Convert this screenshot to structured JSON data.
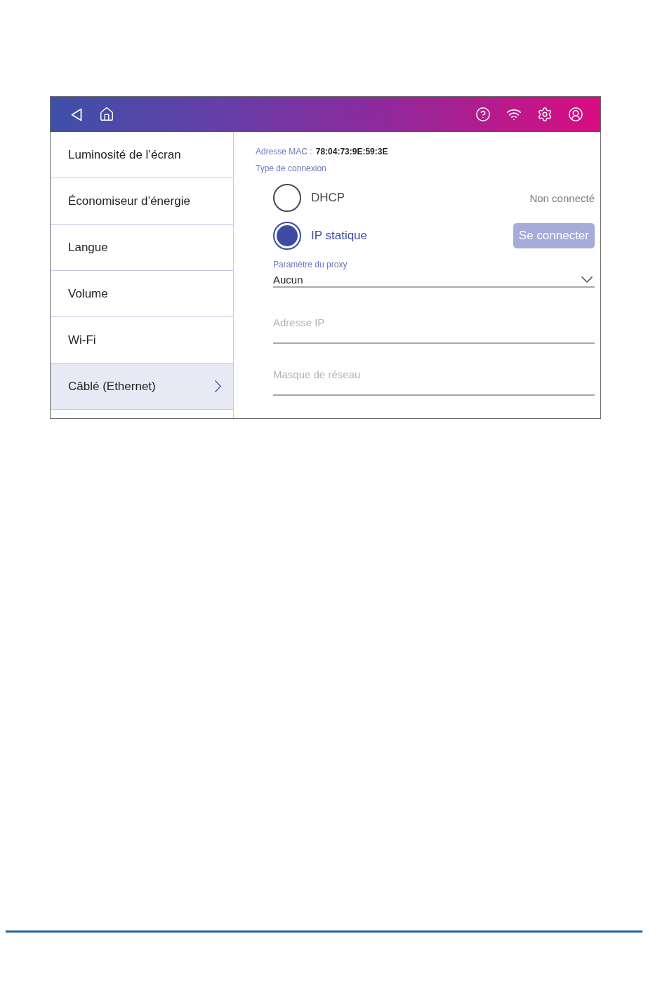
{
  "sidebar": {
    "items": [
      {
        "label": "Luminosité de l’écran",
        "selected": false
      },
      {
        "label": "Économiseur d’énergie",
        "selected": false
      },
      {
        "label": "Langue",
        "selected": false
      },
      {
        "label": "Volume",
        "selected": false
      },
      {
        "label": "Wi-Fi",
        "selected": false
      },
      {
        "label": "Câblé (Ethernet)",
        "selected": true
      }
    ]
  },
  "mac": {
    "label": "Adresse MAC :",
    "value": "78:04:73:9E:59:3E"
  },
  "connection_type": {
    "label": "Type de connexion",
    "options": [
      {
        "label": "DHCP",
        "selected": false,
        "status": "Non connecté"
      },
      {
        "label": "IP statique",
        "selected": true,
        "button": "Se connecter"
      }
    ]
  },
  "proxy": {
    "label": "Paramètre du proxy",
    "value": "Aucun"
  },
  "fields": [
    {
      "placeholder": "Adresse IP"
    },
    {
      "placeholder": "Masque de réseau"
    }
  ]
}
